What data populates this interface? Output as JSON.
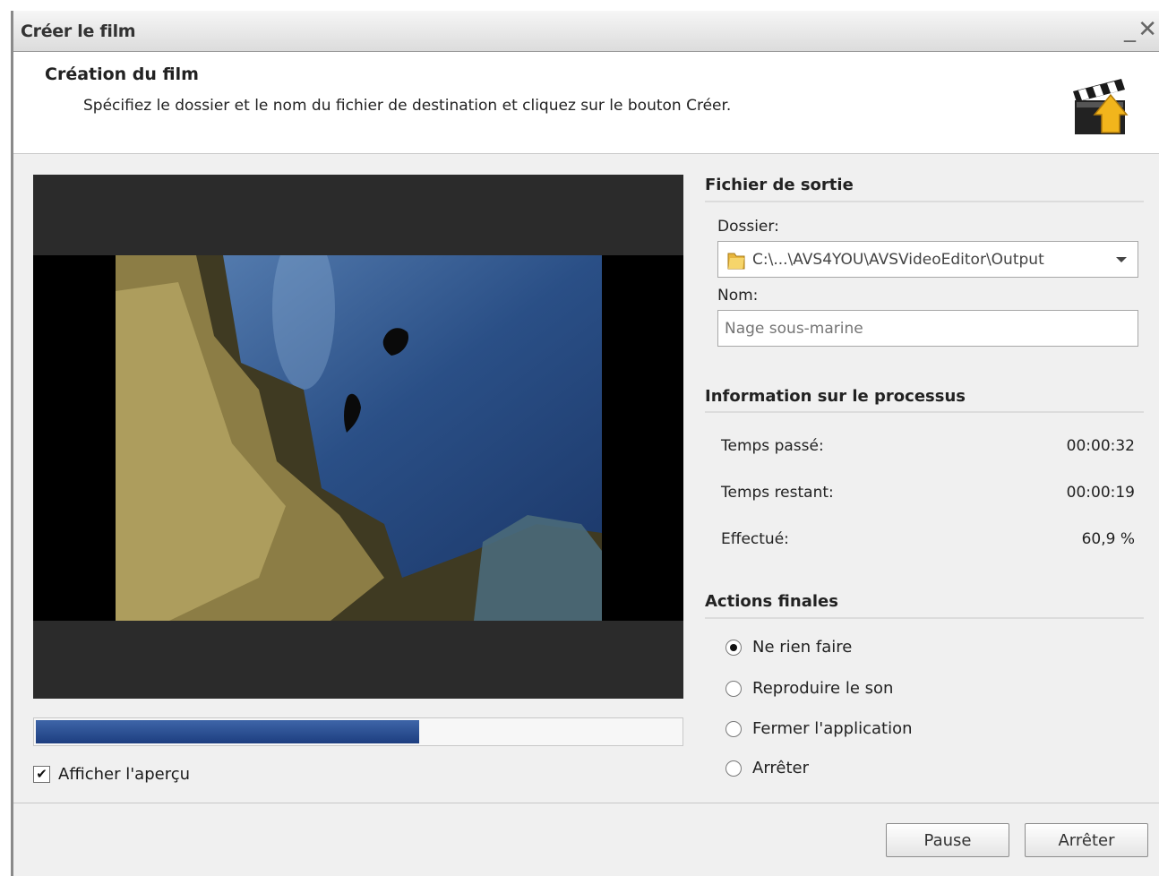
{
  "window": {
    "title": "Créer le film",
    "minimize": "_",
    "close": "✕"
  },
  "header": {
    "title": "Création du film",
    "subtitle": "Spécifiez le dossier et le nom du fichier de destination et cliquez sur le bouton Créer."
  },
  "preview": {
    "show_preview_label": "Afficher l'aperçu",
    "show_preview_checked": true,
    "progress_fraction": 0.596
  },
  "output": {
    "section_title": "Fichier de sortie",
    "folder_label": "Dossier:",
    "folder_value": "C:\\...\\AVS4YOU\\AVSVideoEditor\\Output",
    "name_label": "Nom:",
    "name_placeholder": "Nage sous-marine"
  },
  "process": {
    "section_title": "Information sur le processus",
    "rows": [
      {
        "label": "Temps passé:",
        "value": "00:00:32"
      },
      {
        "label": "Temps restant:",
        "value": "00:00:19"
      },
      {
        "label": "Effectué:",
        "value": "60,9 %"
      }
    ]
  },
  "final_actions": {
    "section_title": "Actions finales",
    "options": [
      {
        "label": "Ne rien faire",
        "selected": true
      },
      {
        "label": "Reproduire le son",
        "selected": false
      },
      {
        "label": "Fermer l'application",
        "selected": false
      },
      {
        "label": "Arrêter",
        "selected": false
      }
    ]
  },
  "buttons": {
    "pause": "Pause",
    "stop": "Arrêter"
  },
  "colors": {
    "progress": "#2a4d91",
    "window_bg": "#f0f0f0",
    "preview_bg": "#2b2b2b"
  }
}
